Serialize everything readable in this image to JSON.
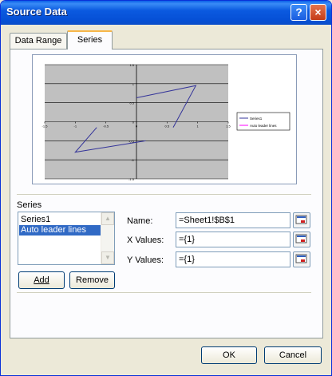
{
  "window": {
    "title": "Source Data",
    "help_glyph": "?",
    "close_glyph": "×"
  },
  "tabs": [
    {
      "label": "Data Range"
    },
    {
      "label": "Series"
    }
  ],
  "chart_data": {
    "type": "line",
    "x_ticks": [
      "-1.5",
      "-1",
      "-0.5",
      "0",
      "0.5",
      "1",
      "1.5"
    ],
    "y_ticks": [
      "1.5",
      "1",
      "0.5",
      "0",
      "-0.5",
      "-1",
      "-1.5"
    ],
    "xlim": [
      -1.5,
      1.5
    ],
    "ylim": [
      -1.5,
      1.5
    ],
    "series": [
      {
        "name": "Series1",
        "color": "#333399",
        "points": [
          [
            0.6,
            -0.15
          ],
          [
            0.97,
            0.95
          ],
          [
            0,
            0.63
          ]
        ]
      },
      {
        "name": "Series1",
        "color": "#333399",
        "points": [
          [
            -0.65,
            -0.15
          ],
          [
            -1.0,
            -0.8
          ],
          [
            0.15,
            -0.5
          ]
        ]
      },
      {
        "name": "Auto leader lines",
        "color": "#ff00ff",
        "points": []
      }
    ],
    "legend": [
      "Series1",
      "Auto leader lines"
    ],
    "legend_position": "right",
    "plot_background": "#c0c0c0"
  },
  "series_section": {
    "label": "Series",
    "items": [
      "Series1",
      "Auto leader lines"
    ],
    "selected_index": 1,
    "add_label": "Add",
    "remove_label": "Remove"
  },
  "fields": {
    "name_label": "Name:",
    "name_value": "=Sheet1!$B$1",
    "x_label": "X Values:",
    "x_value": "={1}",
    "y_label": "Y Values:",
    "y_value": "={1}"
  },
  "footer": {
    "ok_label": "OK",
    "cancel_label": "Cancel"
  }
}
